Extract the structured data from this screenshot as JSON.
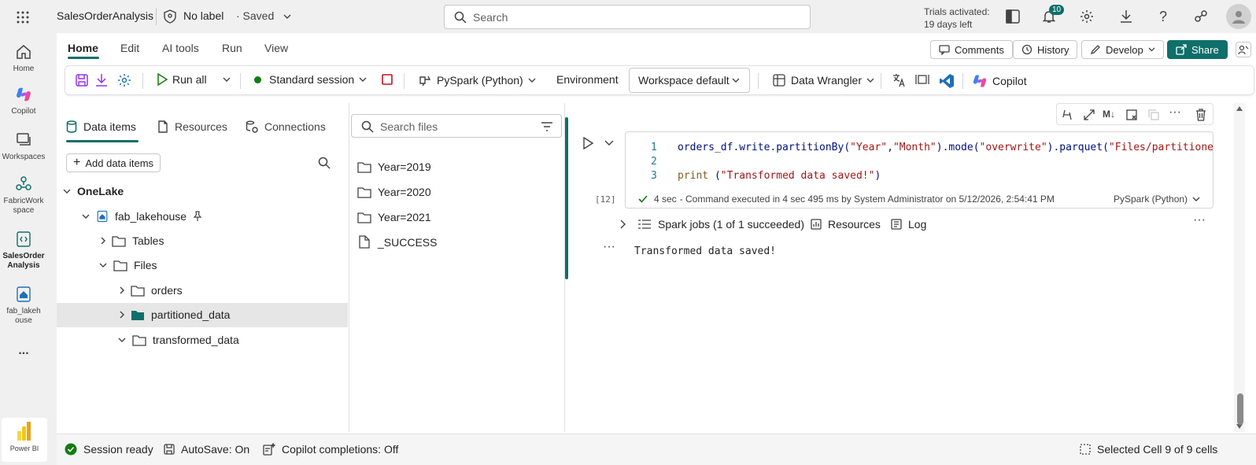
{
  "titlebar": {
    "app_title": "SalesOrderAnalysis",
    "label": "No label",
    "saved": "· Saved",
    "search_placeholder": "Search",
    "trials_line1": "Trials activated:",
    "trials_line2": "19 days left",
    "notification_count": "10"
  },
  "rail": {
    "items": [
      {
        "label": "Home",
        "icon": "home-icon"
      },
      {
        "label": "Copilot",
        "icon": "copilot-icon"
      },
      {
        "label": "Workspaces",
        "icon": "workspaces-icon"
      },
      {
        "label": "FabricWorkspace",
        "icon": "fabric-workspace-icon"
      },
      {
        "label": "SalesOrderAnalysis",
        "icon": "notebook-icon"
      },
      {
        "label": "fab_lakehouse",
        "icon": "lakehouse-icon"
      }
    ],
    "more": "...",
    "powerbi": "Power BI"
  },
  "ribbon": {
    "tabs": [
      "Home",
      "Edit",
      "AI tools",
      "Run",
      "View"
    ],
    "comments": "Comments",
    "history": "History",
    "develop": "Develop",
    "share": "Share"
  },
  "toolbar": {
    "run_all": "Run all",
    "session": "Standard session",
    "language": "PySpark (Python)",
    "environment": "Environment",
    "workspace_default": "Workspace default",
    "data_wrangler": "Data Wrangler",
    "copilot": "Copilot"
  },
  "explorer": {
    "tabs": [
      "Data items",
      "Resources",
      "Connections"
    ],
    "add_data_items": "Add data items",
    "tree": {
      "onelake": "OneLake",
      "lakehouse": "fab_lakehouse",
      "tables": "Tables",
      "files": "Files",
      "orders": "orders",
      "partitioned_data": "partitioned_data",
      "transformed_data": "transformed_data"
    }
  },
  "files": {
    "search_placeholder": "Search files",
    "items": [
      "Year=2019",
      "Year=2020",
      "Year=2021",
      "_SUCCESS"
    ]
  },
  "cell": {
    "line_numbers": [
      "1",
      "2",
      "3"
    ],
    "code_line1_a": "orders_df.write.partitionBy(",
    "code_line1_s1": "\"Year\"",
    "code_line1_comma": ",",
    "code_line1_s2": "\"Month\"",
    "code_line1_b": ").mode(",
    "code_line1_s3": "\"overwrite\"",
    "code_line1_c": ").parquet(",
    "code_line1_s4": "\"Files/partitioned_",
    "code_line3_fn": "print",
    "code_line3_a": " (",
    "code_line3_s": "\"Transformed data saved!\"",
    "code_line3_b": ")",
    "exec_duration": "4 sec",
    "exec_detail": "- Command executed in 4 sec 495 ms by System Administrator on 5/12/2026, 2:54:41 PM",
    "exec_lang": "PySpark (Python)",
    "exec_count": "[12]",
    "spark_jobs": "Spark jobs (1 of 1 succeeded)",
    "resources": "Resources",
    "log": "Log",
    "output": "Transformed data saved!"
  },
  "status": {
    "session": "Session ready",
    "autosave": "AutoSave: On",
    "copilot": "Copilot completions: Off",
    "selected": "Selected Cell 9 of 9 cells"
  },
  "colors": {
    "accent": "#0f6f6a",
    "success": "#107c10"
  }
}
